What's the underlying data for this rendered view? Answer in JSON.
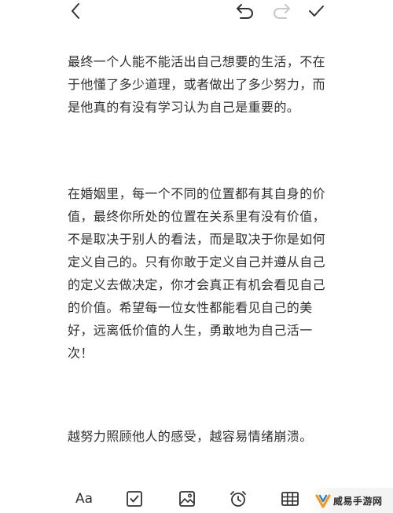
{
  "toolbar": {
    "back_icon": "chevron-left-icon",
    "undo_icon": "undo-icon",
    "redo_icon": "redo-icon",
    "done_icon": "checkmark-icon",
    "redo_enabled": false
  },
  "note": {
    "paragraphs": [
      "最终一个人能不能活出自己想要的生活，不在于他懂了多少道理，或者做出了多少努力，而是他真的有没有学习认为自己是重要的。",
      "在婚姻里，每一个不同的位置都有其自身的价值，最终你所处的位置在关系里有没有价值，不是取决于别人的看法，而是取决于你是如何定义自己的。只有你敢于定义自己并遵从自己的定义去做决定，你才会真正有机会看见自己的价值。希望每一位女性都能看见自己的美好，远离低价值的人生，勇敢地为自己活一次！",
      "越努力照顾他人的感受，越容易情绪崩溃。"
    ]
  },
  "bottombar": {
    "format_label": "Aa",
    "checklist_icon": "checkbox-icon",
    "image_icon": "image-icon",
    "reminder_icon": "alarm-clock-icon",
    "table_icon": "table-icon"
  },
  "watermark": {
    "text": "威易手游网"
  },
  "colors": {
    "text": "#2f2f2f",
    "icon": "#333333",
    "disabled_icon": "#c8c8c8",
    "background": "#ffffff",
    "watermark_orange": "#f39a1e",
    "watermark_blue": "#2f7fd8"
  }
}
